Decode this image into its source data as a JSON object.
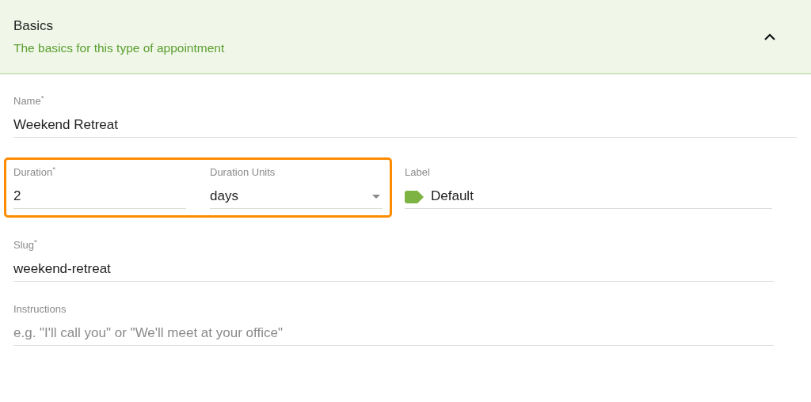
{
  "section": {
    "title": "Basics",
    "subtitle": "The basics for this type of appointment",
    "expanded": true
  },
  "rows": [
    {
      "groups": [
        {
          "highlighted": false,
          "fields": [
            {
              "kind": "text",
              "label": "Name$^{*}$",
              "value": "Weekend Retreat"
            }
          ]
        }
      ]
    },
    {
      "groups": [
        {
          "highlighted": true,
          "fields": [
            {
              "kind": "text",
              "label": "Duration$^{*}$",
              "value": "2"
            },
            {
              "kind": "select",
              "label": "Duration Units",
              "value": "days"
            }
          ]
        },
        {
          "highlighted": false,
          "fields": [
            {
              "kind": "tag",
              "label": "Label",
              "value": "Default"
            }
          ]
        }
      ]
    },
    {
      "groups": [
        {
          "highlighted": false,
          "fields": [
            {
              "kind": "text",
              "label": "Slug$^{*}$",
              "value": "weekend-retreat"
            }
          ]
        }
      ]
    },
    {
      "groups": [
        {
          "highlighted": false,
          "fields": [
            {
              "kind": "text",
              "label": "Instructions",
              "placeholder": "e.g. \"I'll call you\" or \"We'll meet at your office\""
            }
          ]
        }
      ]
    }
  ]
}
